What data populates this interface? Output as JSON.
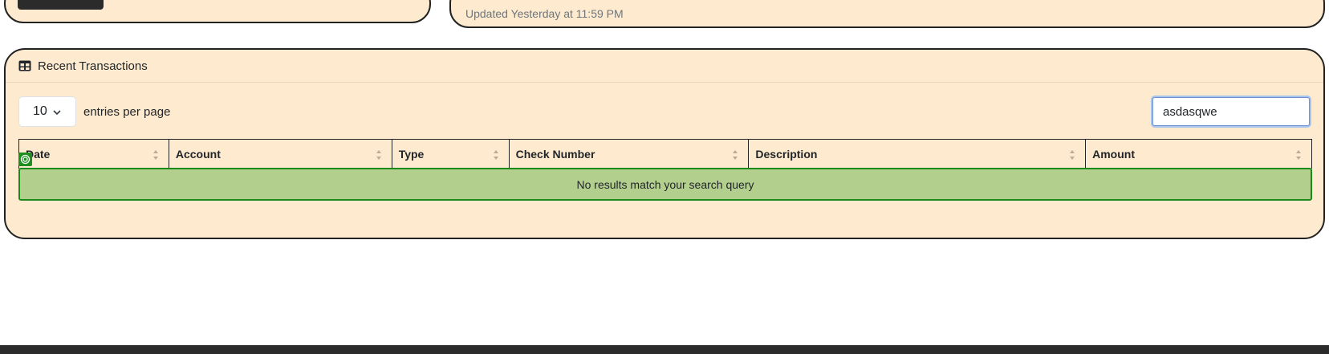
{
  "top_card_right": {
    "updated_text": "Updated Yesterday at 11:59 PM"
  },
  "transactions": {
    "title": "Recent Transactions",
    "icon": "table-icon",
    "entries": {
      "selected": "10",
      "label": "entries per page"
    },
    "search": {
      "value": "asdasqwe"
    },
    "columns": [
      "Date",
      "Account",
      "Type",
      "Check Number",
      "Description",
      "Amount"
    ],
    "empty_message": "No results match your search query"
  },
  "colors": {
    "card_bg": "#feebcf",
    "empty_row_bg": "#b3cf8e",
    "empty_row_border": "#1b8a1b",
    "footer": "#2b2b2b"
  }
}
